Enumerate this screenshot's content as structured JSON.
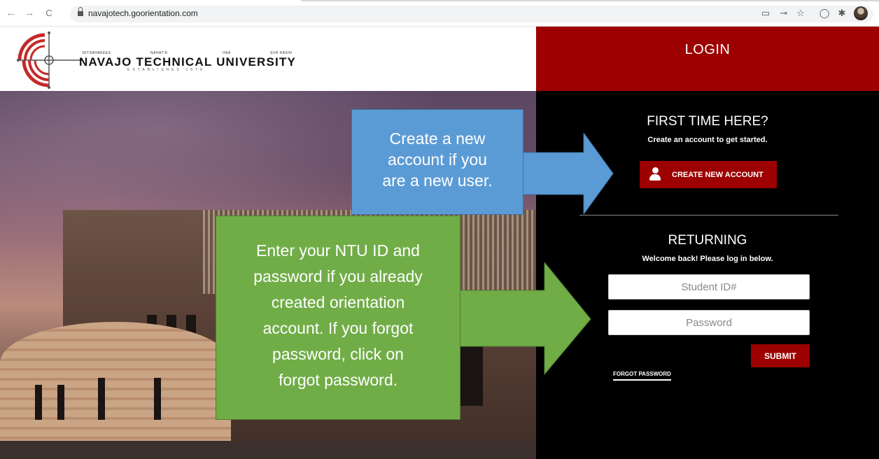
{
  "browser": {
    "url": "navajotech.goorientation.com",
    "back_icon": "←",
    "forward_icon": "→",
    "reload_icon": "C"
  },
  "header": {
    "logo_title": "NAVAJO TECHNICAL UNIVERSITY",
    "logo_words": [
      "NITSAHAKEES",
      "NAHAT'Á",
      "IINÁ",
      "SIIH HASIN"
    ],
    "logo_established": "ESTABLISHED 1979",
    "login_label": "LOGIN"
  },
  "first_time": {
    "title": "FIRST TIME HERE?",
    "subtitle": "Create an account to get started.",
    "button_label": "CREATE NEW ACCOUNT"
  },
  "returning": {
    "title": "RETURNING",
    "subtitle": "Welcome back! Please log in below.",
    "student_id_placeholder": "Student ID#",
    "password_placeholder": "Password",
    "submit_label": "SUBMIT",
    "forgot_label": "FORGOT PASSWORD"
  },
  "callouts": {
    "blue_lines": [
      "Create a new",
      "account if you",
      "are a new user."
    ],
    "green_lines": [
      "Enter your NTU ID and",
      "password if you already",
      "created orientation",
      "account. If you forgot",
      "password, click on",
      "forgot password."
    ]
  },
  "colors": {
    "brand_red": "#9c0000",
    "callout_blue": "#5b9bd5",
    "callout_green": "#70ad47"
  }
}
